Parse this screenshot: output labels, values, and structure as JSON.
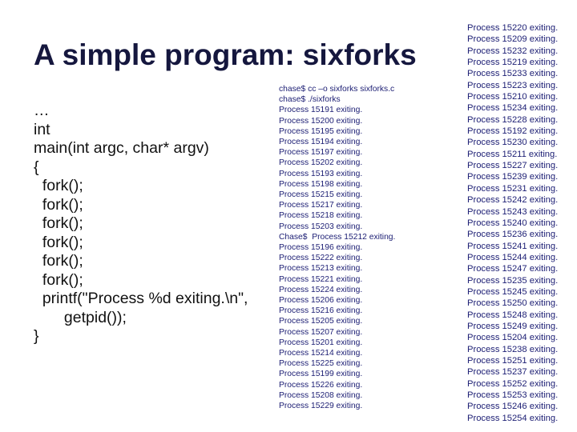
{
  "slide": {
    "title": "A simple program: sixforks",
    "code_lines": [
      "…",
      "int",
      "main(int argc, char* argv)",
      "{",
      "  fork();",
      "  fork();",
      "  fork();",
      "  fork();",
      "  fork();",
      "  fork();",
      "  printf(\"Process %d exiting.\\n\",",
      "       getpid());",
      "}"
    ],
    "terminal_output_middle": [
      "chase$ cc –o sixforks sixforks.c",
      "chase$ ./sixforks",
      "Process 15191 exiting.",
      "Process 15200 exiting.",
      "Process 15195 exiting.",
      "Process 15194 exiting.",
      "Process 15197 exiting.",
      "Process 15202 exiting.",
      "Process 15193 exiting.",
      "Process 15198 exiting.",
      "Process 15215 exiting.",
      "Process 15217 exiting.",
      "Process 15218 exiting.",
      "Process 15203 exiting.",
      "Chase$  Process 15212 exiting.",
      "Process 15196 exiting.",
      "Process 15222 exiting.",
      "Process 15213 exiting.",
      "Process 15221 exiting.",
      "Process 15224 exiting.",
      "Process 15206 exiting.",
      "Process 15216 exiting.",
      "Process 15205 exiting.",
      "Process 15207 exiting.",
      "Process 15201 exiting.",
      "Process 15214 exiting.",
      "Process 15225 exiting.",
      "Process 15199 exiting.",
      "Process 15226 exiting.",
      "Process 15208 exiting.",
      "Process 15229 exiting."
    ],
    "terminal_output_right": [
      "Process 15220 exiting.",
      "Process 15209 exiting.",
      "Process 15232 exiting.",
      "Process 15219 exiting.",
      "Process 15233 exiting.",
      "Process 15223 exiting.",
      "Process 15210 exiting.",
      "Process 15234 exiting.",
      "Process 15228 exiting.",
      "Process 15192 exiting.",
      "Process 15230 exiting.",
      "Process 15211 exiting.",
      "Process 15227 exiting.",
      "Process 15239 exiting.",
      "Process 15231 exiting.",
      "Process 15242 exiting.",
      "Process 15243 exiting.",
      "Process 15240 exiting.",
      "Process 15236 exiting.",
      "Process 15241 exiting.",
      "Process 15244 exiting.",
      "Process 15247 exiting.",
      "Process 15235 exiting.",
      "Process 15245 exiting.",
      "Process 15250 exiting.",
      "Process 15248 exiting.",
      "Process 15249 exiting.",
      "Process 15204 exiting.",
      "Process 15238 exiting.",
      "Process 15251 exiting.",
      "Process 15237 exiting.",
      "Process 15252 exiting.",
      "Process 15253 exiting.",
      "Process 15246 exiting.",
      "Process 15254 exiting."
    ]
  },
  "colors": {
    "title": "#15173e",
    "code": "#111111",
    "terminal_text": "#1b1d73",
    "background": "#ffffff"
  }
}
